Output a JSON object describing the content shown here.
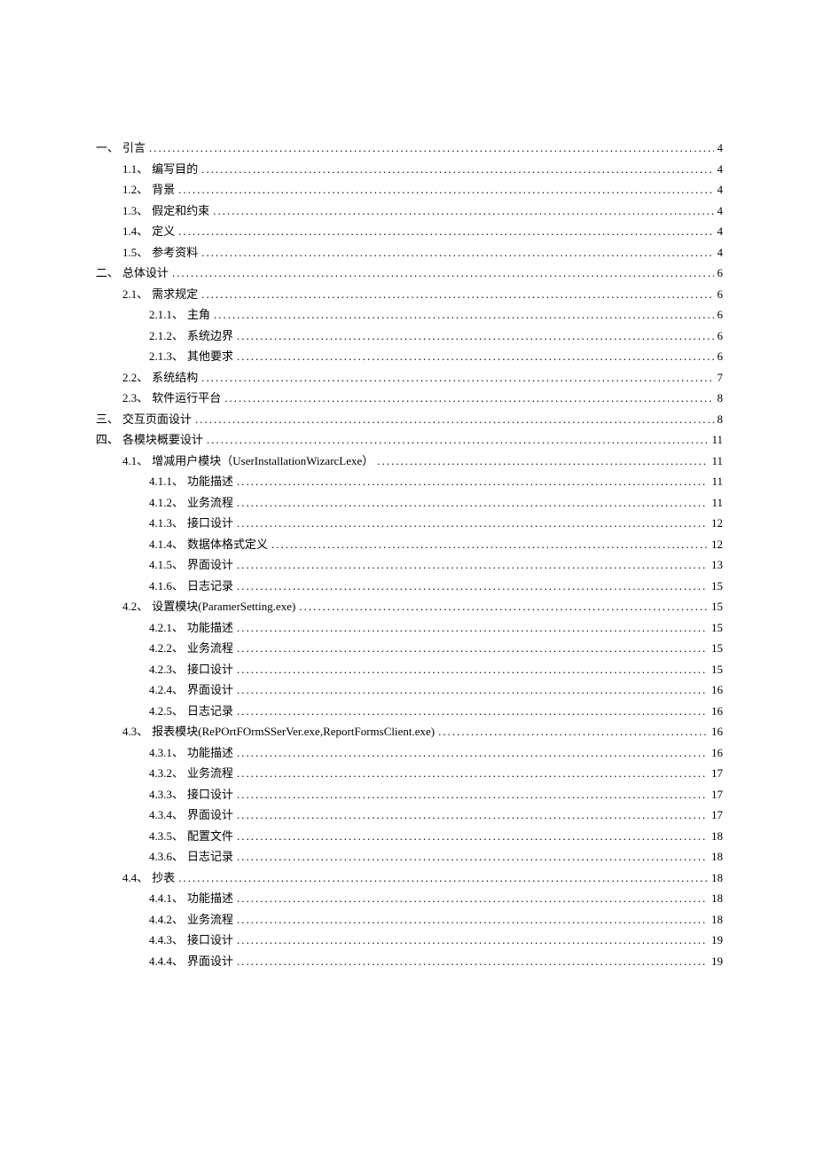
{
  "toc": [
    {
      "indent": 0,
      "number": "一、",
      "title": "引言",
      "page": "4"
    },
    {
      "indent": 1,
      "number": "1.1、",
      "title": "编写目的",
      "page": "4"
    },
    {
      "indent": 1,
      "number": "1.2、",
      "title": "背景",
      "page": "4"
    },
    {
      "indent": 1,
      "number": "1.3、",
      "title": "假定和约束",
      "page": "4"
    },
    {
      "indent": 1,
      "number": "1.4、",
      "title": "定义",
      "page": "4"
    },
    {
      "indent": 1,
      "number": "1.5、",
      "title": "参考资料",
      "page": "4"
    },
    {
      "indent": 0,
      "number": "二、",
      "title": "总体设计",
      "page": "6"
    },
    {
      "indent": 1,
      "number": "2.1、",
      "title": "需求规定",
      "page": "6"
    },
    {
      "indent": 2,
      "number": "2.1.1、",
      "title": "主角",
      "page": "6"
    },
    {
      "indent": 2,
      "number": "2.1.2、",
      "title": "系统边界",
      "page": "6"
    },
    {
      "indent": 2,
      "number": "2.1.3、",
      "title": "其他要求",
      "page": "6"
    },
    {
      "indent": 1,
      "number": "2.2、",
      "title": "系统结构",
      "page": "7"
    },
    {
      "indent": 1,
      "number": "2.3、",
      "title": "软件运行平台",
      "page": "8"
    },
    {
      "indent": 0,
      "number": "三、",
      "title": "交互页面设计",
      "page": "8"
    },
    {
      "indent": 0,
      "number": "四、",
      "title": "各模块概要设计",
      "page": "11"
    },
    {
      "indent": 1,
      "number": "4.1、",
      "title": "增减用户模块（UserInstallationWizarcLexe）",
      "page": "11"
    },
    {
      "indent": 2,
      "number": "4.1.1、",
      "title": "功能描述",
      "page": "11"
    },
    {
      "indent": 2,
      "number": "4.1.2、",
      "title": "业务流程",
      "page": "11"
    },
    {
      "indent": 2,
      "number": "4.1.3、",
      "title": "接口设计",
      "page": "12"
    },
    {
      "indent": 2,
      "number": "4.1.4、",
      "title": "数据体格式定义",
      "page": "12"
    },
    {
      "indent": 2,
      "number": "4.1.5、",
      "title": "界面设计",
      "page": "13"
    },
    {
      "indent": 2,
      "number": "4.1.6、",
      "title": "日志记录",
      "page": "15"
    },
    {
      "indent": 1,
      "number": "4.2、",
      "title": "设置模块(ParamerSetting.exe)",
      "page": "15"
    },
    {
      "indent": 2,
      "number": "4.2.1、",
      "title": "功能描述",
      "page": "15"
    },
    {
      "indent": 2,
      "number": "4.2.2、",
      "title": "业务流程",
      "page": "15"
    },
    {
      "indent": 2,
      "number": "4.2.3、",
      "title": "接口设计",
      "page": "15"
    },
    {
      "indent": 2,
      "number": "4.2.4、",
      "title": "界面设计",
      "page": "16"
    },
    {
      "indent": 2,
      "number": "4.2.5、",
      "title": "日志记录",
      "page": "16"
    },
    {
      "indent": 1,
      "number": "4.3、",
      "title": "报表模块(RePOrtFOrmSSerVer.exe,ReportFormsClient.exe)",
      "page": "16"
    },
    {
      "indent": 2,
      "number": "4.3.1、",
      "title": "功能描述",
      "page": "16"
    },
    {
      "indent": 2,
      "number": "4.3.2、",
      "title": "业务流程",
      "page": "17"
    },
    {
      "indent": 2,
      "number": "4.3.3、",
      "title": "接口设计",
      "page": "17"
    },
    {
      "indent": 2,
      "number": "4.3.4、",
      "title": "界面设计",
      "page": "17"
    },
    {
      "indent": 2,
      "number": "4.3.5、",
      "title": "配置文件",
      "page": "18"
    },
    {
      "indent": 2,
      "number": "4.3.6、",
      "title": "日志记录",
      "page": "18"
    },
    {
      "indent": 1,
      "number": "4.4、",
      "title": "抄表",
      "page": "18"
    },
    {
      "indent": 2,
      "number": "4.4.1、",
      "title": "功能描述",
      "page": "18"
    },
    {
      "indent": 2,
      "number": "4.4.2、",
      "title": "业务流程",
      "page": "18"
    },
    {
      "indent": 2,
      "number": "4.4.3、",
      "title": "接口设计",
      "page": "19"
    },
    {
      "indent": 2,
      "number": "4.4.4、",
      "title": "界面设计",
      "page": "19"
    }
  ]
}
